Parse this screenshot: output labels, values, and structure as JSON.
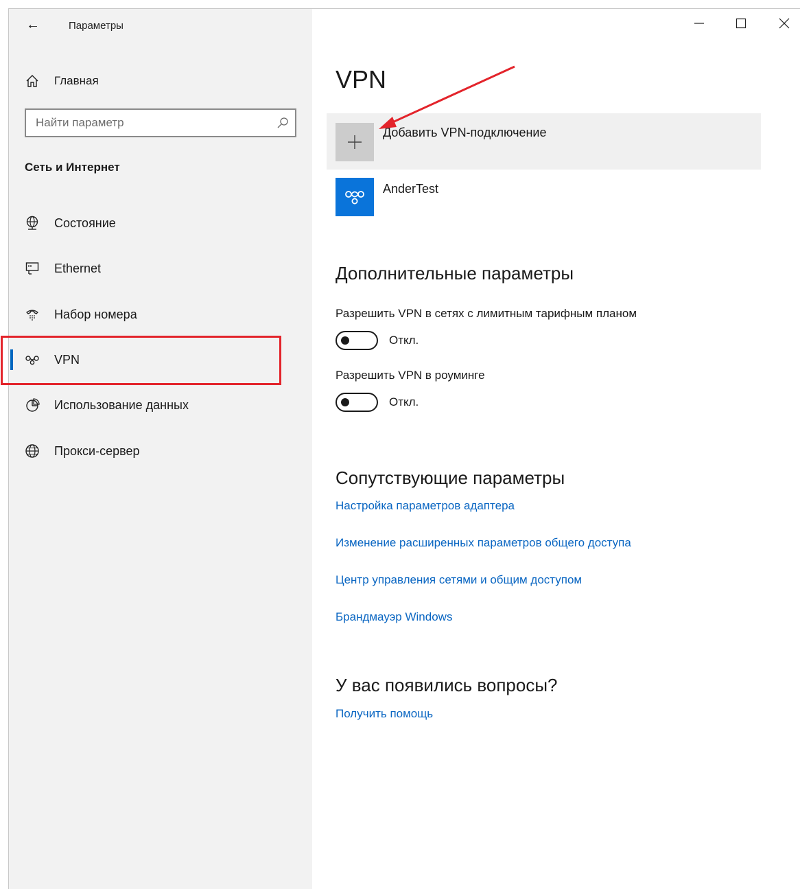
{
  "window": {
    "title": "Параметры",
    "back_icon": "arrow-left-icon",
    "minimize_icon": "minimize-icon",
    "maximize_icon": "maximize-icon",
    "close_icon": "close-icon"
  },
  "sidebar": {
    "home_label": "Главная",
    "search_placeholder": "Найти параметр",
    "section_title": "Сеть и Интернет",
    "items": [
      {
        "label": "Состояние",
        "icon": "globe-network-icon"
      },
      {
        "label": "Ethernet",
        "icon": "ethernet-icon"
      },
      {
        "label": "Набор номера",
        "icon": "dialup-icon"
      },
      {
        "label": "VPN",
        "icon": "vpn-icon",
        "selected": true
      },
      {
        "label": "Использование данных",
        "icon": "data-usage-icon"
      },
      {
        "label": "Прокси-сервер",
        "icon": "globe-icon"
      }
    ]
  },
  "main": {
    "title": "VPN",
    "add_vpn_label": "Добавить VPN-подключение",
    "connections": [
      {
        "name": "AnderTest"
      }
    ],
    "advanced": {
      "heading": "Дополнительные параметры",
      "settings": [
        {
          "label": "Разрешить VPN в сетях с лимитным тарифным планом",
          "state": "Откл."
        },
        {
          "label": "Разрешить VPN в роуминге",
          "state": "Откл."
        }
      ]
    },
    "related": {
      "heading": "Сопутствующие параметры",
      "links": [
        "Настройка параметров адаптера",
        "Изменение расширенных параметров общего доступа",
        "Центр управления сетями и общим доступом",
        "Брандмауэр Windows"
      ]
    },
    "questions": {
      "heading": "У вас появились вопросы?",
      "link": "Получить помощь"
    }
  },
  "colors": {
    "accent": "#0067c0",
    "link": "#0a66c2",
    "annotation_red": "#e3242b",
    "vpn_tile": "#0a74da"
  }
}
